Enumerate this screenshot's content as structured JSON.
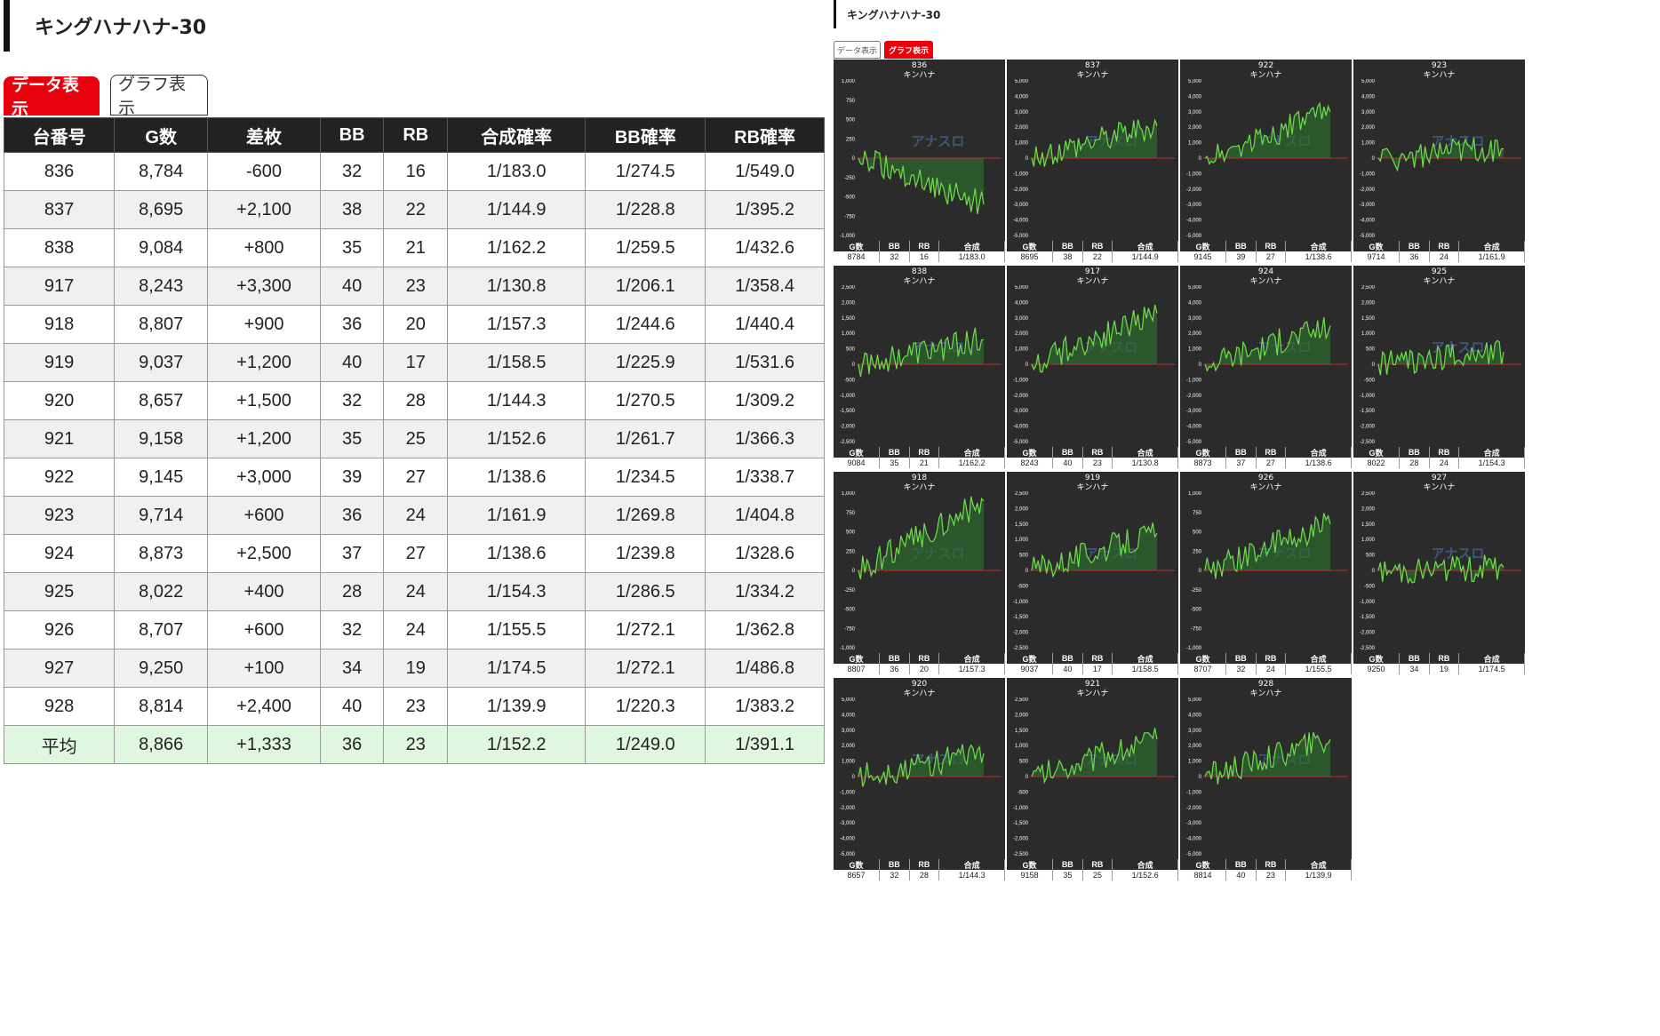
{
  "left": {
    "title": "キングハナハナ-30",
    "tabs": {
      "data_label": "データ表示",
      "graph_label": "グラフ表示"
    },
    "columns": [
      "台番号",
      "G数",
      "差枚",
      "BB",
      "RB",
      "合成確率",
      "BB確率",
      "RB確率"
    ],
    "rows": [
      [
        "836",
        "8,784",
        "-600",
        "32",
        "16",
        "1/183.0",
        "1/274.5",
        "1/549.0"
      ],
      [
        "837",
        "8,695",
        "+2,100",
        "38",
        "22",
        "1/144.9",
        "1/228.8",
        "1/395.2"
      ],
      [
        "838",
        "9,084",
        "+800",
        "35",
        "21",
        "1/162.2",
        "1/259.5",
        "1/432.6"
      ],
      [
        "917",
        "8,243",
        "+3,300",
        "40",
        "23",
        "1/130.8",
        "1/206.1",
        "1/358.4"
      ],
      [
        "918",
        "8,807",
        "+900",
        "36",
        "20",
        "1/157.3",
        "1/244.6",
        "1/440.4"
      ],
      [
        "919",
        "9,037",
        "+1,200",
        "40",
        "17",
        "1/158.5",
        "1/225.9",
        "1/531.6"
      ],
      [
        "920",
        "8,657",
        "+1,500",
        "32",
        "28",
        "1/144.3",
        "1/270.5",
        "1/309.2"
      ],
      [
        "921",
        "9,158",
        "+1,200",
        "35",
        "25",
        "1/152.6",
        "1/261.7",
        "1/366.3"
      ],
      [
        "922",
        "9,145",
        "+3,000",
        "39",
        "27",
        "1/138.6",
        "1/234.5",
        "1/338.7"
      ],
      [
        "923",
        "9,714",
        "+600",
        "36",
        "24",
        "1/161.9",
        "1/269.8",
        "1/404.8"
      ],
      [
        "924",
        "8,873",
        "+2,500",
        "37",
        "27",
        "1/138.6",
        "1/239.8",
        "1/328.6"
      ],
      [
        "925",
        "8,022",
        "+400",
        "28",
        "24",
        "1/154.3",
        "1/286.5",
        "1/334.2"
      ],
      [
        "926",
        "8,707",
        "+600",
        "32",
        "24",
        "1/155.5",
        "1/272.1",
        "1/362.8"
      ],
      [
        "927",
        "9,250",
        "+100",
        "34",
        "19",
        "1/174.5",
        "1/272.1",
        "1/486.8"
      ],
      [
        "928",
        "8,814",
        "+2,400",
        "40",
        "23",
        "1/139.9",
        "1/220.3",
        "1/383.2"
      ]
    ],
    "average": [
      "平均",
      "8,866",
      "+1,333",
      "36",
      "23",
      "1/152.2",
      "1/249.0",
      "1/391.1"
    ]
  },
  "right": {
    "title": "キングハナハナ-30",
    "tabs": {
      "data_label": "データ表示",
      "graph_label": "グラフ表示"
    },
    "machine_name": "キンハナ",
    "footer_headers": [
      "G数",
      "BB",
      "RB",
      "合成"
    ],
    "watermark": "アナスロ",
    "colors": {
      "line": "#6fe04a",
      "zero": "#c0282f",
      "fill": "#2e6b2e"
    },
    "cards": [
      {
        "id": "836",
        "scale": 1000,
        "ticks": [
          "1,000",
          "750",
          "500",
          "250",
          "0",
          "-250",
          "-500",
          "-750",
          "-1,000"
        ],
        "g": "8784",
        "bb": "32",
        "rb": "16",
        "p": "1/183.0",
        "final": -600
      },
      {
        "id": "837",
        "scale": 5000,
        "ticks": [
          "5,000",
          "4,000",
          "3,000",
          "2,000",
          "1,000",
          "0",
          "-1,000",
          "-2,000",
          "-3,000",
          "-4,000",
          "-5,000"
        ],
        "g": "8695",
        "bb": "38",
        "rb": "22",
        "p": "1/144.9",
        "final": 2100
      },
      {
        "id": "922",
        "scale": 5000,
        "ticks": [
          "5,000",
          "4,000",
          "3,000",
          "2,000",
          "1,000",
          "0",
          "-1,000",
          "-2,000",
          "-3,000",
          "-4,000",
          "-5,000"
        ],
        "g": "9145",
        "bb": "39",
        "rb": "27",
        "p": "1/138.6",
        "final": 3000
      },
      {
        "id": "923",
        "scale": 5000,
        "ticks": [
          "5,000",
          "4,000",
          "3,000",
          "2,000",
          "1,000",
          "0",
          "-1,000",
          "-2,000",
          "-3,000",
          "-4,000",
          "-5,000"
        ],
        "g": "9714",
        "bb": "36",
        "rb": "24",
        "p": "1/161.9",
        "final": 600
      },
      {
        "id": "838",
        "scale": 2500,
        "ticks": [
          "2,500",
          "2,000",
          "1,500",
          "1,000",
          "500",
          "0",
          "-500",
          "-1,000",
          "-1,500",
          "-2,000",
          "-2,500"
        ],
        "g": "9084",
        "bb": "35",
        "rb": "21",
        "p": "1/162.2",
        "final": 800
      },
      {
        "id": "917",
        "scale": 5000,
        "ticks": [
          "5,000",
          "4,000",
          "3,000",
          "2,000",
          "1,000",
          "0",
          "-1,000",
          "-2,000",
          "-3,000",
          "-4,000",
          "-5,000"
        ],
        "g": "8243",
        "bb": "40",
        "rb": "23",
        "p": "1/130.8",
        "final": 3300
      },
      {
        "id": "924",
        "scale": 5000,
        "ticks": [
          "5,000",
          "4,000",
          "3,000",
          "2,000",
          "1,000",
          "0",
          "-1,000",
          "-2,000",
          "-3,000",
          "-4,000",
          "-5,000"
        ],
        "g": "8873",
        "bb": "37",
        "rb": "27",
        "p": "1/138.6",
        "final": 2500
      },
      {
        "id": "925",
        "scale": 2500,
        "ticks": [
          "2,500",
          "2,000",
          "1,500",
          "1,000",
          "500",
          "0",
          "-500",
          "-1,000",
          "-1,500",
          "-2,000",
          "-2,500"
        ],
        "g": "8022",
        "bb": "28",
        "rb": "24",
        "p": "1/154.3",
        "final": 400
      },
      {
        "id": "918",
        "scale": 1000,
        "ticks": [
          "1,000",
          "750",
          "500",
          "250",
          "0",
          "-250",
          "-500",
          "-750",
          "-1,000"
        ],
        "g": "8807",
        "bb": "36",
        "rb": "20",
        "p": "1/157.3",
        "final": 900
      },
      {
        "id": "919",
        "scale": 2500,
        "ticks": [
          "2,500",
          "2,000",
          "1,500",
          "1,000",
          "500",
          "0",
          "-500",
          "-1,000",
          "-1,500",
          "-2,000",
          "-2,500"
        ],
        "g": "9037",
        "bb": "40",
        "rb": "17",
        "p": "1/158.5",
        "final": 1200
      },
      {
        "id": "926",
        "scale": 1000,
        "ticks": [
          "1,000",
          "750",
          "500",
          "250",
          "0",
          "-250",
          "-500",
          "-750",
          "-1,000"
        ],
        "g": "8707",
        "bb": "32",
        "rb": "24",
        "p": "1/155.5",
        "final": 600
      },
      {
        "id": "927",
        "scale": 2500,
        "ticks": [
          "2,500",
          "2,000",
          "1,500",
          "1,000",
          "500",
          "0",
          "-500",
          "-1,000",
          "-1,500",
          "-2,000",
          "-2,500"
        ],
        "g": "9250",
        "bb": "34",
        "rb": "19",
        "p": "1/174.5",
        "final": 100
      },
      {
        "id": "920",
        "scale": 5000,
        "ticks": [
          "5,000",
          "4,000",
          "3,000",
          "2,000",
          "1,000",
          "0",
          "-1,000",
          "-2,000",
          "-3,000",
          "-4,000",
          "-5,000"
        ],
        "g": "8657",
        "bb": "32",
        "rb": "28",
        "p": "1/144.3",
        "final": 1500
      },
      {
        "id": "921",
        "scale": 2500,
        "ticks": [
          "2,500",
          "2,000",
          "1,500",
          "1,000",
          "500",
          "0",
          "-500",
          "-1,000",
          "-1,500",
          "-2,000",
          "-2,500"
        ],
        "g": "9158",
        "bb": "35",
        "rb": "25",
        "p": "1/152.6",
        "final": 1200
      },
      {
        "id": "928",
        "scale": 5000,
        "ticks": [
          "5,000",
          "4,000",
          "3,000",
          "2,000",
          "1,000",
          "0",
          "-1,000",
          "-2,000",
          "-3,000",
          "-4,000",
          "-5,000"
        ],
        "g": "8814",
        "bb": "40",
        "rb": "23",
        "p": "1/139.9",
        "final": 2400
      }
    ]
  }
}
